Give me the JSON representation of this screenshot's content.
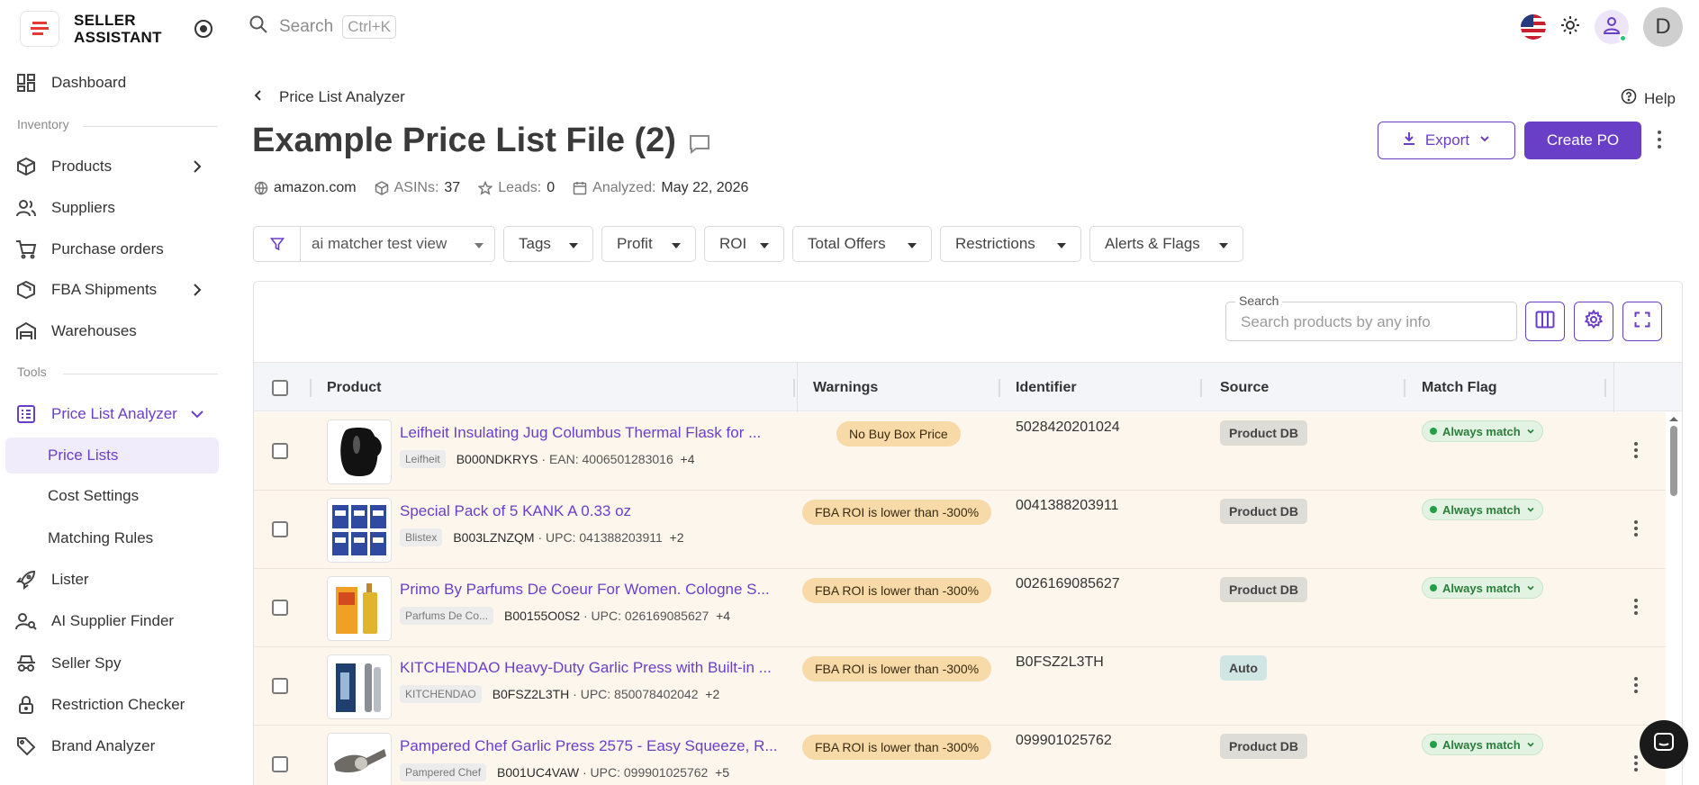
{
  "brand": {
    "line1": "SELLER",
    "line2": "ASSISTANT"
  },
  "sidebar": {
    "dashboard": "Dashboard",
    "inventory_label": "Inventory",
    "products": "Products",
    "suppliers": "Suppliers",
    "purchase_orders": "Purchase orders",
    "fba_shipments": "FBA Shipments",
    "warehouses": "Warehouses",
    "tools_label": "Tools",
    "price_list_analyzer": "Price List Analyzer",
    "price_lists": "Price Lists",
    "cost_settings": "Cost Settings",
    "matching_rules": "Matching Rules",
    "lister": "Lister",
    "ai_supplier_finder": "AI Supplier Finder",
    "seller_spy": "Seller Spy",
    "restriction_checker": "Restriction Checker",
    "brand_analyzer": "Brand Analyzer"
  },
  "topbar": {
    "search_placeholder": "Search",
    "shortcut": "Ctrl+K",
    "avatar_letter": "D"
  },
  "header": {
    "breadcrumb": "Price List Analyzer",
    "help": "Help",
    "title": "Example Price List File (2)",
    "export_label": "Export",
    "create_po_label": "Create PO",
    "site": "amazon.com",
    "asins_label": "ASINs:",
    "asins_value": "37",
    "leads_label": "Leads:",
    "leads_value": "0",
    "analyzed_label": "Analyzed:",
    "analyzed_value": "May 22, 2026"
  },
  "filters": {
    "view": "ai matcher test view",
    "tags": "Tags",
    "profit": "Profit",
    "roi": "ROI",
    "total_offers": "Total Offers",
    "restrictions": "Restrictions",
    "alerts_flags": "Alerts & Flags"
  },
  "table": {
    "search_label": "Search",
    "search_placeholder": "Search products by any info",
    "columns": {
      "product": "Product",
      "warnings": "Warnings",
      "identifier": "Identifier",
      "source": "Source",
      "match_flag": "Match Flag"
    },
    "rows": [
      {
        "title": "Leifheit Insulating Jug Columbus Thermal Flask for ...",
        "brand": "Leifheit",
        "asin": "B000NDKRYS",
        "code": "· EAN: 4006501283016",
        "more": "+4",
        "warning": "No Buy Box Price",
        "identifier": "5028420201024",
        "source": "Product DB",
        "match": "Always match"
      },
      {
        "title": "Special Pack of 5 KANK A 0.33 oz",
        "brand": "Blistex",
        "asin": "B003LZNZQM",
        "code": "· UPC: 041388203911",
        "more": "+2",
        "warning": "FBA ROI is lower than -300%",
        "identifier": "0041388203911",
        "source": "Product DB",
        "match": "Always match"
      },
      {
        "title": "Primo By Parfums De Coeur For Women. Cologne S...",
        "brand": "Parfums De Co...",
        "asin": "B00155O0S2",
        "code": "· UPC: 026169085627",
        "more": "+4",
        "warning": "FBA ROI is lower than -300%",
        "identifier": "0026169085627",
        "source": "Product DB",
        "match": "Always match"
      },
      {
        "title": "KITCHENDAO Heavy-Duty Garlic Press with Built-in ...",
        "brand": "KITCHENDAO",
        "asin": "B0FSZ2L3TH",
        "code": "· UPC: 850078402042",
        "more": "+2",
        "warning": "FBA ROI is lower than -300%",
        "identifier": "B0FSZ2L3TH",
        "source": "Auto",
        "match": ""
      },
      {
        "title": "Pampered Chef Garlic Press 2575 - Easy Squeeze, R...",
        "brand": "Pampered Chef",
        "asin": "B001UC4VAW",
        "code": "· UPC: 099901025762",
        "more": "+5",
        "warning": "FBA ROI is lower than -300%",
        "identifier": "099901025762",
        "source": "Product DB",
        "match": "Always match"
      }
    ]
  }
}
